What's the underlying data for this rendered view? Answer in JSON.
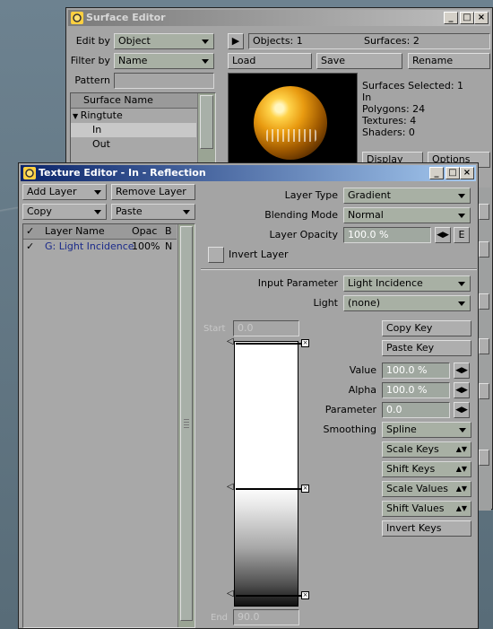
{
  "surface_editor": {
    "title": "Surface Editor",
    "edit_by_label": "Edit by",
    "edit_by_value": "Object",
    "filter_by_label": "Filter by",
    "filter_by_value": "Name",
    "pattern_label": "Pattern",
    "objects_count": "Objects: 1",
    "surfaces_count": "Surfaces: 2",
    "load_label": "Load",
    "save_label": "Save",
    "rename_label": "Rename",
    "list_header": "Surface Name",
    "tree": [
      {
        "label": "Ringtute",
        "level": 0
      },
      {
        "label": "In",
        "level": 1
      },
      {
        "label": "Out",
        "level": 1
      }
    ],
    "info": [
      "Surfaces Selected: 1",
      "In",
      "Polygons: 24",
      "Textures: 4",
      "Shaders: 0"
    ],
    "display_label": "Display",
    "options_label": "Options"
  },
  "texture_editor": {
    "title": "Texture Editor - In - Reflection",
    "add_layer": "Add Layer",
    "remove_layer": "Remove Layer",
    "copy": "Copy",
    "paste": "Paste",
    "columns": {
      "check": "✓",
      "name": "Layer Name",
      "opac": "Opac",
      "b": "B"
    },
    "layers": [
      {
        "check": "✓",
        "name": "G: Light Incidence",
        "opac": "100%",
        "b": "N"
      }
    ],
    "layer_type_label": "Layer Type",
    "layer_type_value": "Gradient",
    "blending_mode_label": "Blending Mode",
    "blending_mode_value": "Normal",
    "layer_opacity_label": "Layer Opacity",
    "layer_opacity_value": "100.0 %",
    "envelope_btn": "E",
    "invert_layer_label": "Invert Layer",
    "input_parameter_label": "Input Parameter",
    "input_parameter_value": "Light Incidence",
    "light_label": "Light",
    "light_value": "(none)",
    "start_label": "Start",
    "start_value": "0.0",
    "end_label": "End",
    "end_value": "90.0",
    "copy_key": "Copy Key",
    "paste_key": "Paste Key",
    "value_label": "Value",
    "value_value": "100.0 %",
    "alpha_label": "Alpha",
    "alpha_value": "100.0 %",
    "parameter_label": "Parameter",
    "parameter_value": "0.0",
    "smoothing_label": "Smoothing",
    "smoothing_value": "Spline",
    "scale_keys": "Scale Keys",
    "shift_keys": "Shift Keys",
    "scale_values": "Scale Values",
    "shift_values": "Shift Values",
    "invert_keys": "Invert Keys"
  },
  "colors": {
    "active_title": "#0a246a",
    "panel": "#a4a4a4",
    "layer_text": "#1a2a8a"
  }
}
